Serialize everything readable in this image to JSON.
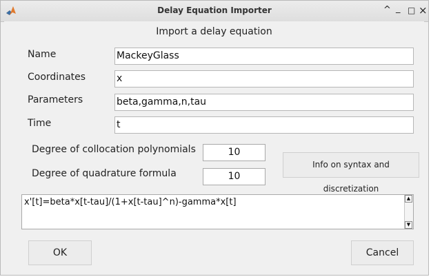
{
  "window": {
    "title": "Delay Equation Importer",
    "controls": {
      "minimize": "_",
      "maximize": "□",
      "close": "×",
      "restore": "^"
    }
  },
  "heading": "Import a delay equation",
  "form": {
    "name": {
      "label": "Name",
      "value": "MackeyGlass"
    },
    "coordinates": {
      "label": "Coordinates",
      "value": "x"
    },
    "parameters": {
      "label": "Parameters",
      "value": "beta,gamma,n,tau"
    },
    "time": {
      "label": "Time",
      "value": "t"
    }
  },
  "degrees": {
    "collocation": {
      "label": "Degree of collocation polynomials",
      "value": "10"
    },
    "quadrature": {
      "label": "Degree of quadrature formula",
      "value": "10"
    }
  },
  "info_button": "Info on syntax and discretization",
  "equation": "x'[t]=beta*x[t-tau]/(1+x[t-tau]^n)-gamma*x[t]",
  "buttons": {
    "ok": "OK",
    "cancel": "Cancel"
  },
  "icons": {
    "app": "matlab-icon",
    "scroll_up": "arrow-up-icon",
    "scroll_down": "arrow-down-icon"
  }
}
